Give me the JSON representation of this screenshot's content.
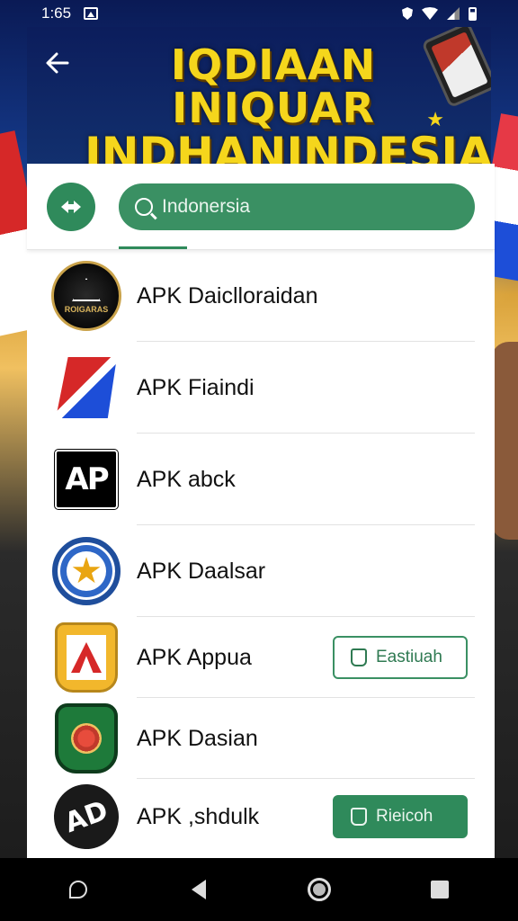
{
  "status_bar": {
    "time": "1:65",
    "icons": [
      "image-icon",
      "shield-icon",
      "wifi-icon",
      "signal-icon",
      "battery-icon"
    ]
  },
  "banner": {
    "title_line1": "IQDIAAN INIQUAR",
    "title_line2": "INDHANINDESIA",
    "back_icon": "arrow-left-icon"
  },
  "search": {
    "value": "Indonersia",
    "filter_icon": "swap-arrows-icon",
    "search_icon": "search-icon"
  },
  "apps": [
    {
      "name": "APK Daiclloraidan",
      "icon": "dark-circle-logo",
      "icon_text": "ROIGARAS"
    },
    {
      "name": "APK Fiaindi",
      "icon": "red-blue-flag-logo"
    },
    {
      "name": "APK abck",
      "icon": "ap-black-logo",
      "icon_text": "AP"
    },
    {
      "name": "APK Daalsar",
      "icon": "blue-star-badge-logo"
    },
    {
      "name": "APK Appua",
      "icon": "gold-shield-logo",
      "action": "Eastiuah",
      "action_style": "outline"
    },
    {
      "name": "APK Dasian",
      "icon": "green-badge-logo"
    },
    {
      "name": "APK ,shdulk",
      "icon": "dark-ap-circle-logo",
      "icon_text": "AD",
      "action": "Rieicoh",
      "action_style": "filled"
    }
  ],
  "colors": {
    "accent_green": "#2f8a5b",
    "banner_navy": "#0c1d5c",
    "title_yellow": "#f5d61c"
  },
  "nav_bar": {
    "buttons": [
      "assistant-icon",
      "back-triangle-icon",
      "home-circle-icon",
      "recents-square-icon"
    ]
  }
}
